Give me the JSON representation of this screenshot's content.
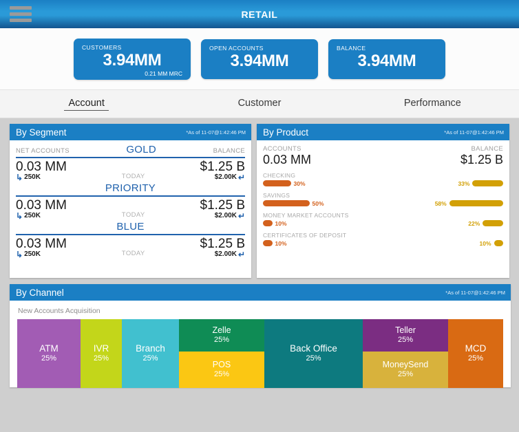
{
  "topbar": {
    "title": "RETAIL",
    "menu_icon": "hamburger-menu-icon"
  },
  "kpis": [
    {
      "label": "CUSTOMERS",
      "value": "3.94MM",
      "sub": "0.21 MM MRC"
    },
    {
      "label": "OPEN ACCOUNTS",
      "value": "3.94MM",
      "sub": ""
    },
    {
      "label": "BALANCE",
      "value": "3.94MM",
      "sub": ""
    }
  ],
  "tabs": [
    {
      "label": "Account",
      "active": true
    },
    {
      "label": "Customer",
      "active": false
    },
    {
      "label": "Performance",
      "active": false
    }
  ],
  "segment": {
    "title": "By Segment",
    "stamp": "*As of 11-07@1:42:46 PM",
    "col_left": "NET ACCOUNTS",
    "col_right": "BALANCE",
    "today_label": "TODAY",
    "left_arrow": "↳",
    "right_arrow": "↵",
    "tiers": [
      {
        "name": "GOLD",
        "accounts": "0.03 MM",
        "accounts_delta": "250K",
        "balance": "$1.25 B",
        "balance_delta": "$2.00K"
      },
      {
        "name": "PRIORITY",
        "accounts": "0.03 MM",
        "accounts_delta": "250K",
        "balance": "$1.25 B",
        "balance_delta": "$2.00K"
      },
      {
        "name": "BLUE",
        "accounts": "0.03 MM",
        "accounts_delta": "250K",
        "balance": "$1.25 B",
        "balance_delta": "$2.00K"
      }
    ]
  },
  "product": {
    "title": "By Product",
    "stamp": "*As of 11-07@1:42:46 PM",
    "col_left": "ACCOUNTS",
    "col_right": "BALANCE",
    "accounts_total": "0.03 MM",
    "balance_total": "$1.25 B",
    "items": [
      {
        "name": "CHECKING",
        "accounts_pct": "30%",
        "accounts_val": 30,
        "balance_pct": "33%",
        "balance_val": 33
      },
      {
        "name": "SAVINGS",
        "accounts_pct": "50%",
        "accounts_val": 50,
        "balance_pct": "58%",
        "balance_val": 58
      },
      {
        "name": "MONEY MARKET ACCOUNTS",
        "accounts_pct": "10%",
        "accounts_val": 10,
        "balance_pct": "22%",
        "balance_val": 22
      },
      {
        "name": "CERTIFICATES OF DEPOSIT",
        "accounts_pct": "10%",
        "accounts_val": 10,
        "balance_pct": "10%",
        "balance_val": 10
      }
    ]
  },
  "channel": {
    "title": "By Channel",
    "stamp": "*As of 11-07@1:42:46 PM",
    "subtitle": "New Accounts Acquisition",
    "tiles": [
      {
        "name": "ATM",
        "pct": "25%",
        "color": "#a25cb4",
        "width": 92,
        "height": 100,
        "stacked": false
      },
      {
        "name": "IVR",
        "pct": "25%",
        "color": "#c3d61a",
        "width": 60,
        "height": 100,
        "stacked": false
      },
      {
        "name": "Branch",
        "pct": "25%",
        "color": "#41c0cf",
        "width": 83,
        "height": 100,
        "stacked": false
      },
      {
        "name": "Zelle",
        "pct": "25%",
        "color": "#0f8c55",
        "width": 124,
        "height": 47,
        "stacked": true
      },
      {
        "name": "POS",
        "pct": "25%",
        "color": "#fbc713",
        "width": 124,
        "height": 53,
        "stacked": true
      },
      {
        "name": "Back Office",
        "pct": "25%",
        "color": "#0d7a7f",
        "width": 143,
        "height": 100,
        "stacked": false
      },
      {
        "name": "Teller",
        "pct": "25%",
        "color": "#7b2d82",
        "width": 124,
        "height": 47,
        "stacked": true
      },
      {
        "name": "MoneySend",
        "pct": "25%",
        "color": "#d8b23c",
        "width": 124,
        "height": 53,
        "stacked": true
      },
      {
        "name": "MCD",
        "pct": "25%",
        "color": "#d96a13",
        "width": 80,
        "height": 100,
        "stacked": false
      }
    ]
  }
}
